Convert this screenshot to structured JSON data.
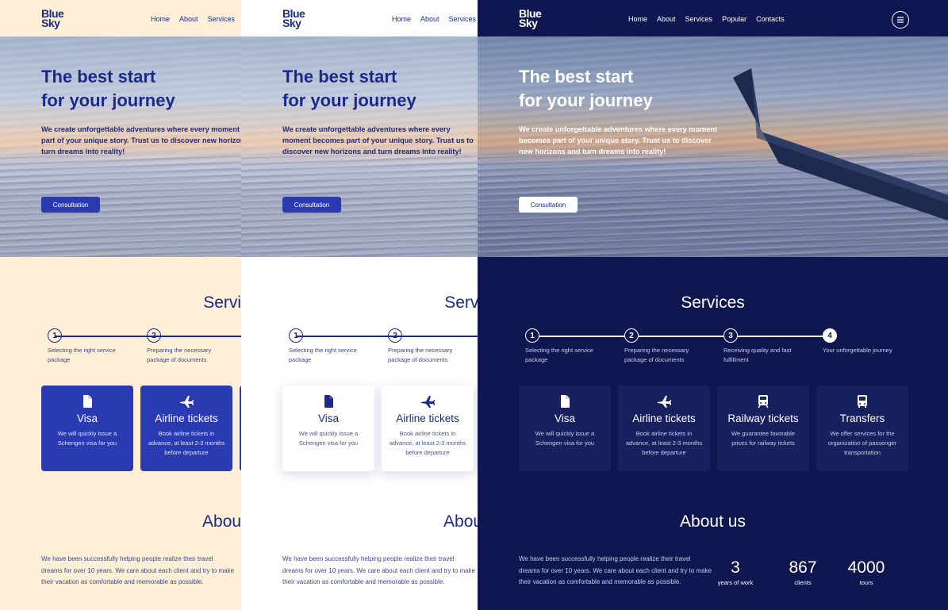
{
  "brand": {
    "logo": "Blue Sky"
  },
  "nav": [
    "Home",
    "About",
    "Services",
    "Popular",
    "Contacts"
  ],
  "hero": {
    "title_line1": "The best start",
    "title_line2": "for your journey",
    "text": "We create unforgettable adventures where every moment becomes part of your unique story. Trust us to discover new horizons and turn dreams into reality!",
    "cta": "Consultation"
  },
  "services": {
    "title": "Services",
    "steps": [
      {
        "num": "1",
        "text": "Selecting the right service package"
      },
      {
        "num": "2",
        "text": "Preparing the necessary package of documents"
      },
      {
        "num": "3",
        "text": "Receiving quality and fast fulfillment"
      },
      {
        "num": "4",
        "text": "Your unforgettable journey"
      }
    ],
    "cards": [
      {
        "icon": "document-icon",
        "title": "Visa",
        "text": "We will quickly issue a Schengen visa for you"
      },
      {
        "icon": "airplane-icon",
        "title": "Airline tickets",
        "text": "Book airline tickets in advance, at least 2-3 months before departure"
      },
      {
        "icon": "train-icon",
        "title": "Railway tickets",
        "text": "We guarantee favorable prices for railway tickets"
      },
      {
        "icon": "bus-icon",
        "title": "Transfers",
        "text": "We offer services for the organization of passenger transportation"
      }
    ]
  },
  "about": {
    "title": "About us",
    "text": "We have been successfully helping people realize their travel dreams for over 10 years. We care about each client and try to make their vacation as comfortable and memorable as possible.",
    "stats": [
      {
        "num": "3",
        "label": "years of work"
      },
      {
        "num": "867",
        "label": "clients"
      },
      {
        "num": "4000",
        "label": "tours"
      }
    ]
  },
  "colors": {
    "navy": "#0f1750",
    "accent_blue": "#2a3ab0",
    "cream": "#fdf0d6",
    "white": "#ffffff"
  }
}
